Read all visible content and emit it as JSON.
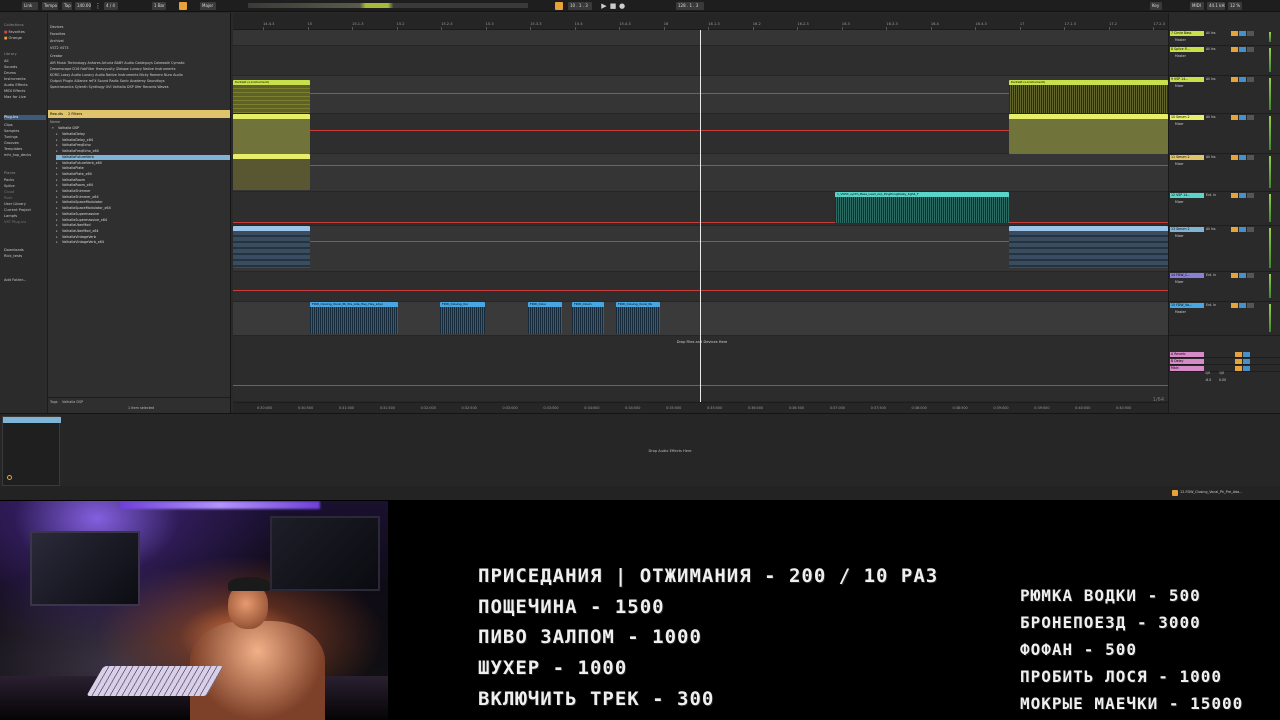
{
  "daw": {
    "topbar": {
      "items": [
        "Link",
        "Tempo",
        "Tap",
        "140.00",
        "4 / 4",
        "1 Bar",
        "Major",
        "10 . 1 . 3",
        "128 . 1 . 3",
        "Key",
        "MIDI",
        "44.1 kHz",
        "12 %"
      ]
    },
    "browser": {
      "places_head": "Collections",
      "places": [
        "Favorites",
        "Orange",
        "Library",
        "All",
        "Sounds",
        "Drums",
        "Instruments",
        "Audio Effects",
        "MIDI Effects",
        "Max for Live",
        "Plug-Ins",
        "Clips",
        "Samples",
        "Tunings",
        "Grooves",
        "Templates",
        "mhr_top_decks"
      ],
      "places2_head": "Places",
      "places2": [
        "Packs",
        "Splice",
        "Cloud",
        "Push",
        "User Library",
        "Current Project",
        "Lampfs",
        "VST Plug-ins",
        "Downloads",
        "Rick_tests",
        "Add Folder..."
      ],
      "label_rows": [
        "Devices",
        "Favorites",
        "Archival",
        "VST2  VST3",
        "Creator",
        "AIR Music Technology  Antares  Arturia  BABY Audio  Cableguys  Cakewalk  Cymatic",
        "Dreamscape  D16  FabFilter  Heavyocity  iZotope  Lunacy  Native Instruments",
        "KORG  Lossy Audio  Lunacy Audio  Native Instruments  Nicky Romero  Nura Audio",
        "Output  Plugin Alliance  reFX  Sound Radix  Sonic Academy  Soundtoys",
        "Spectrasonics  Sylenth  Synthogy  UVI  Valhalla DSP  Xfer Records  Waves"
      ],
      "filter_label": "Results",
      "filter_value": "2 Filters",
      "list_head": "Name",
      "folder": "Valhalla DSP",
      "files": [
        "ValhallaDelay",
        "ValhallaDelay_x64",
        "ValhallaFreqEcho",
        "ValhallaFreqEcho_x64",
        "ValhallaFutureVerb",
        "ValhallaFutureVerb_x64",
        "ValhallaPlate",
        "ValhallaPlate_x64",
        "ValhallaRoom",
        "ValhallaRoom_x64",
        "ValhallaShimmer",
        "ValhallaShimmer_x64",
        "ValhallaSpaceModulator",
        "ValhallaSpaceModulator_x64",
        "ValhallaSupermassive",
        "ValhallaSupermassive_x64",
        "ValhallaUberMod",
        "ValhallaUberMod_x64",
        "ValhallaVintageVerb",
        "ValhallaVintageVerb_x64"
      ],
      "selected_index": 4,
      "footer_tags": "Tags",
      "footer_path": "Valhalla DSP",
      "footer_count": "1 item selected"
    },
    "ruler": [
      "14.4.3",
      "15",
      "15.1.3",
      "15.2",
      "15.2.3",
      "15.3",
      "15.3.3",
      "15.4",
      "15.4.3",
      "16",
      "16.1.3",
      "16.2",
      "16.2.3",
      "16.3",
      "16.3.3",
      "16.4",
      "16.4.3",
      "17",
      "17.1.3",
      "17.2",
      "17.2.3"
    ],
    "time_row": [
      "0:30:000",
      "0:30:500",
      "0:31:000",
      "0:31:500",
      "0:32:000",
      "0:32:500",
      "0:33:000",
      "0:33:500",
      "0:34:000",
      "0:34:500",
      "0:35:000",
      "0:35:500",
      "0:36:000",
      "0:36:500",
      "0:37:000",
      "0:37:500",
      "0:38:000",
      "0:38:500",
      "0:39:000",
      "0:39:500",
      "0:40:000",
      "0:40:500"
    ],
    "clips": {
      "lime1": "Kontakt (L-Instrument)",
      "lime2": "Kontakt (L-Instrument)",
      "teal": "1_VN3X_synth_Bass_Lead_Arp_PingPongDelay_Kgh4_F",
      "blue1": "FDW_Closing_Vocal_Pk_Pre_Ada_Hey_Hey_Ldyo",
      "blue2": "FDW_Closing_Voc",
      "blue3": "FDW_Closi",
      "blue4": "FDW_Closin",
      "blue5": "FDW_Closing_Vocal_Pe"
    },
    "drop_hint": "Drop Files and Devices Here",
    "page_count": "1/64",
    "tracks": [
      {
        "name": "7 Circle Bass",
        "color": "#c8e04a",
        "route": "All Ins",
        "mode": "Master"
      },
      {
        "name": "8 Splice Fl...",
        "color": "#c8e04a",
        "route": "All Ins",
        "mode": "Master"
      },
      {
        "name": "9 VSP 14...",
        "color": "#c8e04a",
        "route": "All Ins",
        "mode": "Mixer"
      },
      {
        "name": "10 Serum 2",
        "color": "#e7ef6a",
        "route": "All Ins",
        "mode": "Mixer"
      },
      {
        "name": "11 Serum 2",
        "color": "#e0c46c",
        "route": "All Ins",
        "mode": "Mixer"
      },
      {
        "name": "12 VSP 14...",
        "color": "#59d4c9",
        "route": "Ext. In",
        "mode": "Mixer"
      },
      {
        "name": "13 Serum 2",
        "color": "#7fb4d6",
        "route": "All Ins",
        "mode": "Mixer"
      },
      {
        "name": "14 FDW_C...",
        "color": "#8a7fd6",
        "route": "Ext. In",
        "mode": "Mixer"
      },
      {
        "name": "15 FDW_Vo...",
        "color": "#4aa6e0",
        "route": "Ext. In",
        "mode": "Master"
      }
    ],
    "returns": [
      {
        "name": "A Reverb",
        "color": "#d68ac8"
      },
      {
        "name": "B Delay",
        "color": "#d68ac8"
      },
      {
        "name": "Main",
        "color": "#d68ac8"
      }
    ],
    "master_values": [
      "1/0",
      "1/0",
      "-6.0",
      "0.00"
    ],
    "device_drop": "Drop Audio Effects Here",
    "status_file": "12-FDW_Closing_Vocal_Pk_Pre_Ada..."
  },
  "overlay": {
    "left_rules": [
      "ПРИСЕДАНИЯ | ОТЖИМАНИЯ - 200 / 10 РАЗ",
      "ПОЩЕЧИНА - 1500",
      "ПИВО ЗАЛПОМ - 1000",
      "ШУХЕР - 1000",
      "ВКЛЮЧИТЬ ТРЕК - 300"
    ],
    "right_rules": [
      "РЮМКА ВОДКИ - 500",
      "БРОНЕПОЕЗД - 3000",
      "ФОФАН - 500",
      "ПРОБИТЬ ЛОСЯ - 1000",
      "МОКРЫЕ МАЕЧКИ - 15000"
    ]
  }
}
